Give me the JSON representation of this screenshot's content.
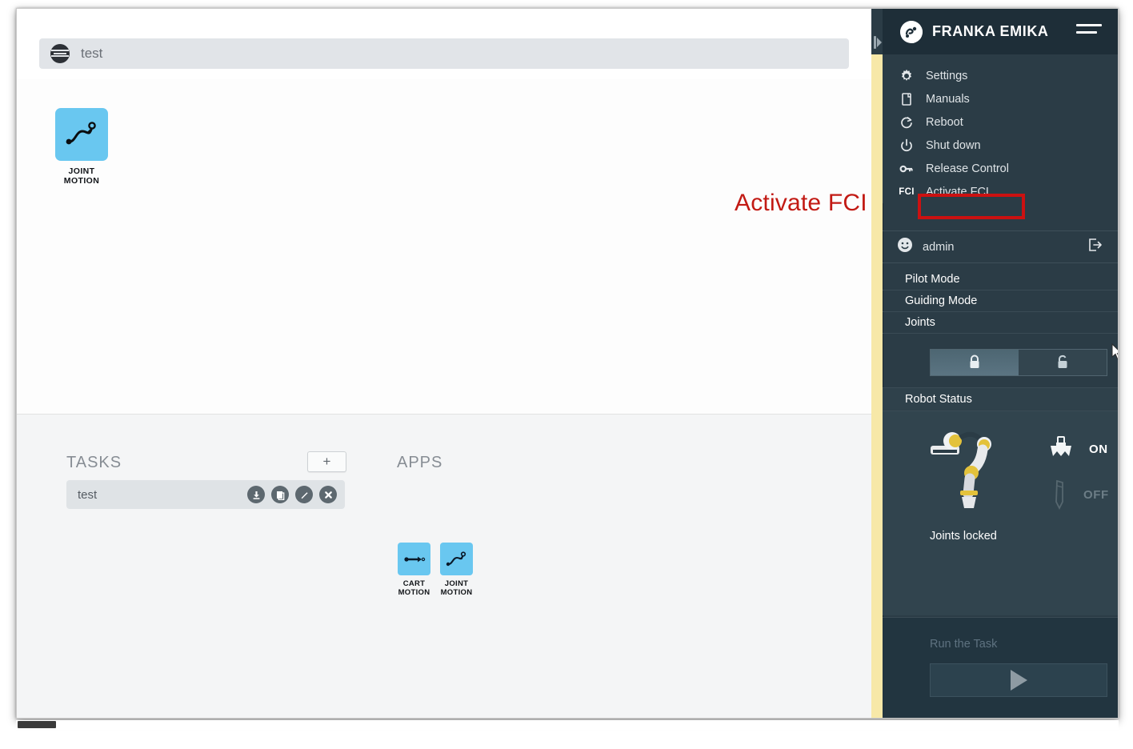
{
  "breadcrumb": {
    "icon": "globe-icon",
    "text": "test"
  },
  "canvas": {
    "blocks": [
      {
        "label_line1": "JOINT",
        "label_line2": "MOTION",
        "icon": "joint-motion-icon"
      }
    ]
  },
  "bottom": {
    "tasks_title": "TASKS",
    "apps_title": "APPS",
    "add_button_label": "+",
    "tasks": [
      {
        "name": "test",
        "actions": [
          {
            "name": "download-icon"
          },
          {
            "name": "duplicate-icon"
          },
          {
            "name": "edit-icon"
          },
          {
            "name": "delete-icon"
          }
        ]
      }
    ],
    "apps": [
      {
        "label_line1": "CART",
        "label_line2": "MOTION",
        "icon": "cart-motion-icon"
      },
      {
        "label_line1": "JOINT",
        "label_line2": "MOTION",
        "icon": "joint-motion-icon"
      }
    ]
  },
  "sidebar": {
    "brand": "FRANKA EMIKA",
    "menu": [
      {
        "label": "Settings",
        "icon": "gear-icon"
      },
      {
        "label": "Manuals",
        "icon": "book-icon"
      },
      {
        "label": "Reboot",
        "icon": "reboot-icon"
      },
      {
        "label": "Shut down",
        "icon": "power-icon"
      },
      {
        "label": "Release Control",
        "icon": "key-icon"
      },
      {
        "label": "Activate FCI",
        "icon": "fci-badge",
        "badge": "FCI",
        "highlighted": true
      }
    ],
    "account": {
      "name": "admin",
      "logout_icon": "logout-icon"
    },
    "modes": [
      {
        "label": "Pilot Mode"
      },
      {
        "label": "Guiding Mode"
      },
      {
        "label": "Joints"
      }
    ],
    "lock_toggle": {
      "locked_icon": "padlock-locked-icon",
      "unlocked_icon": "padlock-unlocked-icon",
      "selected": "locked"
    },
    "robot_status": {
      "title": "Robot Status",
      "joints_text": "Joints locked",
      "gripper_state": "ON",
      "tool_state": "OFF"
    },
    "run": {
      "label": "Run the Task",
      "play_icon": "play-icon"
    }
  },
  "annotation": {
    "text": "Activate FCI",
    "color": "#c21a14"
  },
  "colors": {
    "sidebar_bg": "#2b3c46",
    "sidebar_header_bg": "#1e2e38",
    "tile_blue": "#69c7f0",
    "yellow_strip": "#f7e8a8",
    "highlight_red": "#cc1111"
  }
}
